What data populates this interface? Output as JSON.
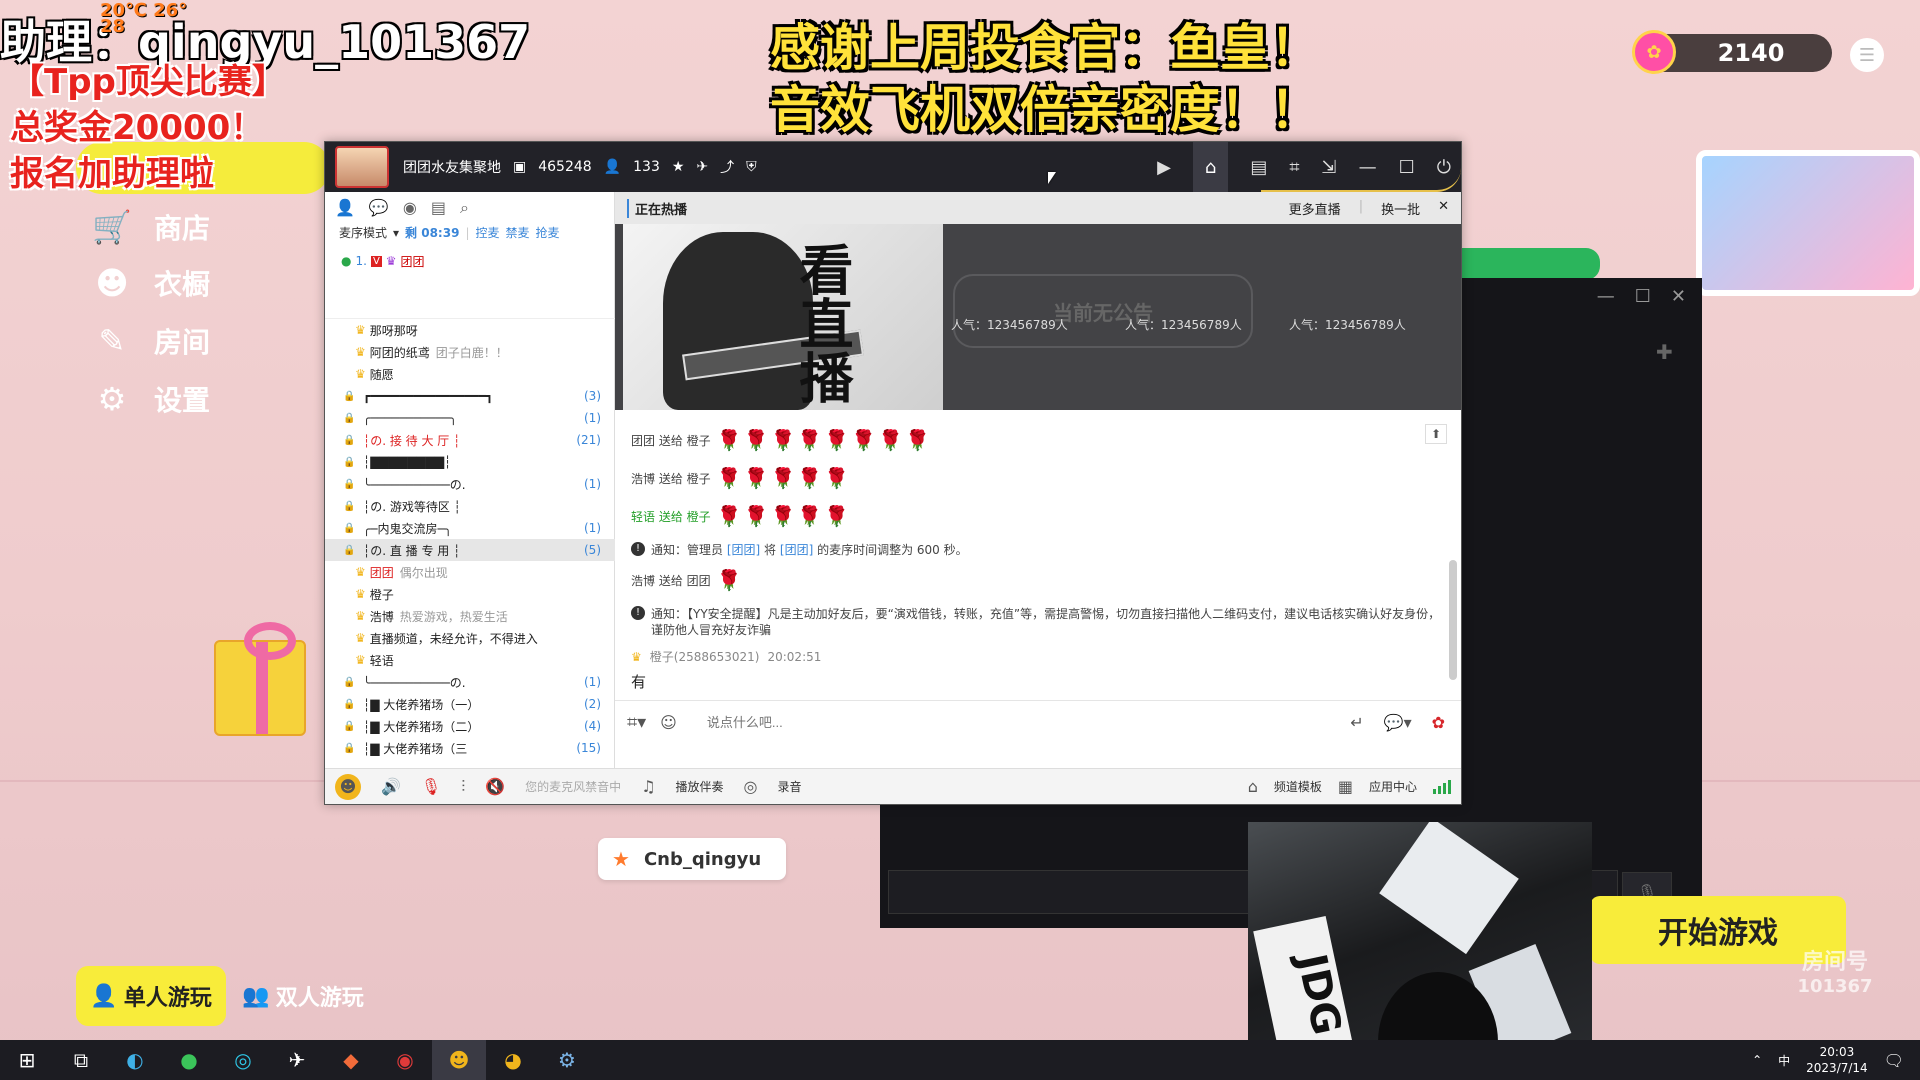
{
  "overlay": {
    "assistant": "助理：qingyu_101367",
    "weather_high": "26°",
    "weather_low": "20℃",
    "weather_c": "28",
    "promo_lines": [
      "【Tpp顶尖比赛】",
      "总奖金20000！",
      "报名加助理啦"
    ],
    "thanks_lines": [
      "感谢上周投食官：鱼皇！",
      "音效飞机双倍亲密度！！"
    ]
  },
  "game_menu": {
    "items": [
      {
        "label": "商店",
        "icon": "cart-icon"
      },
      {
        "label": "衣橱",
        "icon": "wardrobe-icon"
      },
      {
        "label": "房间",
        "icon": "wrench-icon"
      },
      {
        "label": "设置",
        "icon": "gear-icon"
      }
    ]
  },
  "score": {
    "value": "2140"
  },
  "name_tag": {
    "label": "Cnb_qingyu"
  },
  "buttons": {
    "single": "单人游玩",
    "double": "双人游玩",
    "start": "开始游戏"
  },
  "room_badge": {
    "line1": "房间号",
    "line2": "101367"
  },
  "yy": {
    "channel_name": "团团水友集聚地",
    "channel_id": "465248",
    "online": "133",
    "left": {
      "mode": "麦序模式",
      "countdown": "剩 08:39",
      "actions": [
        "控麦",
        "禁麦",
        "抢麦"
      ],
      "queue_item": "1.",
      "queue_name": "团团",
      "tree": [
        {
          "type": "user",
          "name": "那呀那呀",
          "extra": "",
          "sel": false
        },
        {
          "type": "user",
          "name": "阿团的纸鸢",
          "extra": "团子白鹿！！",
          "sel": false
        },
        {
          "type": "user",
          "name": "随愿",
          "extra": "",
          "sel": false
        },
        {
          "type": "chan",
          "name": "┏━━━━━━━━━━━━━━━━┓",
          "count": "(3)",
          "sel": false
        },
        {
          "type": "chan",
          "name": "╭───────────╮",
          "count": "(1)",
          "sel": false
        },
        {
          "type": "chan",
          "name": "┆の. 接 待 大 厅 ┆",
          "count": "(21)",
          "sel": false,
          "red": true
        },
        {
          "type": "chan",
          "name": "┆▇▇▇▇▇▇▇▇┆",
          "count": "",
          "sel": false
        },
        {
          "type": "chan",
          "name": "╰───────────の.",
          "count": "(1)",
          "sel": false
        },
        {
          "type": "chan",
          "name": "┆の. 游戏等待区 ┆",
          "count": "",
          "sel": false
        },
        {
          "type": "chan",
          "name": "╭─内鬼交流房─╮",
          "count": "(1)",
          "sel": false
        },
        {
          "type": "chan",
          "name": "┆の. 直 播 专 用 ┆",
          "count": "(5)",
          "sel": true
        },
        {
          "type": "user",
          "name": "团团",
          "extra": "偶尔出现",
          "sel": false,
          "red": true
        },
        {
          "type": "user",
          "name": "橙子",
          "extra": "",
          "sel": false
        },
        {
          "type": "user",
          "name": "浩博",
          "extra": "热爱游戏，热爱生活",
          "sel": false
        },
        {
          "type": "user",
          "name": "直播频道，未经允许，不得进入",
          "extra": "",
          "sel": false
        },
        {
          "type": "user",
          "name": "轻语",
          "extra": "",
          "sel": false
        },
        {
          "type": "chan",
          "name": "╰───────────の.",
          "count": "(1)",
          "sel": false
        },
        {
          "type": "chan",
          "name": "┆▇ 大佬养猪场（一）",
          "count": "(2)",
          "sel": false
        },
        {
          "type": "chan",
          "name": "┆▇ 大佬养猪场（二）",
          "count": "(4)",
          "sel": false
        },
        {
          "type": "chan",
          "name": "┆▇ 大佬养猪场（三",
          "count": "(15)",
          "sel": false
        }
      ]
    },
    "hot": {
      "title": "正在热播",
      "more": "更多直播",
      "refresh": "换一批",
      "image_text": "看直播",
      "notice": "当前无公告",
      "popularity": [
        "人气：123456789人",
        "人气：123456789人",
        "人气：123456789人"
      ]
    },
    "chat": {
      "gifts": [
        {
          "text": "团团 送给 橙子",
          "roses": "🌹🌹🌹🌹🌹🌹🌹🌹",
          "green": false
        },
        {
          "text": "浩博 送给 橙子",
          "roses": "🌹🌹🌹🌹🌹",
          "green": false
        },
        {
          "text": "轻语 送给 橙子",
          "roses": "🌹🌹🌹🌹🌹",
          "green": true
        }
      ],
      "notice1_pre": "通知：管理员",
      "notice1_a": "[团团]",
      "notice1_mid": "将",
      "notice1_b": "[团团]",
      "notice1_post": "的麦序时间调整为 600 秒。",
      "gift4": "浩博 送给 团团",
      "gift4_roses": "🌹",
      "notice2": "通知：【YY安全提醒】凡是主动加好友后，要“演戏借钱，转账，充值”等，需提高警惕，切勿直接扫描他人二维码支付，建议电话核实确认好友身份，谨防他人冒充好友诈骗",
      "sender": "橙子(2588653021)",
      "time": "20:02:51",
      "message": "有"
    },
    "input_placeholder": "说点什么吧...",
    "bottom": {
      "mic_status": "您的麦克风禁音中",
      "accompany": "播放伴奏",
      "record": "录音",
      "template": "频道模板",
      "app_center": "应用中心"
    }
  },
  "taskbar": {
    "ime": "中",
    "time": "20:03",
    "date": "2023/7/14"
  }
}
